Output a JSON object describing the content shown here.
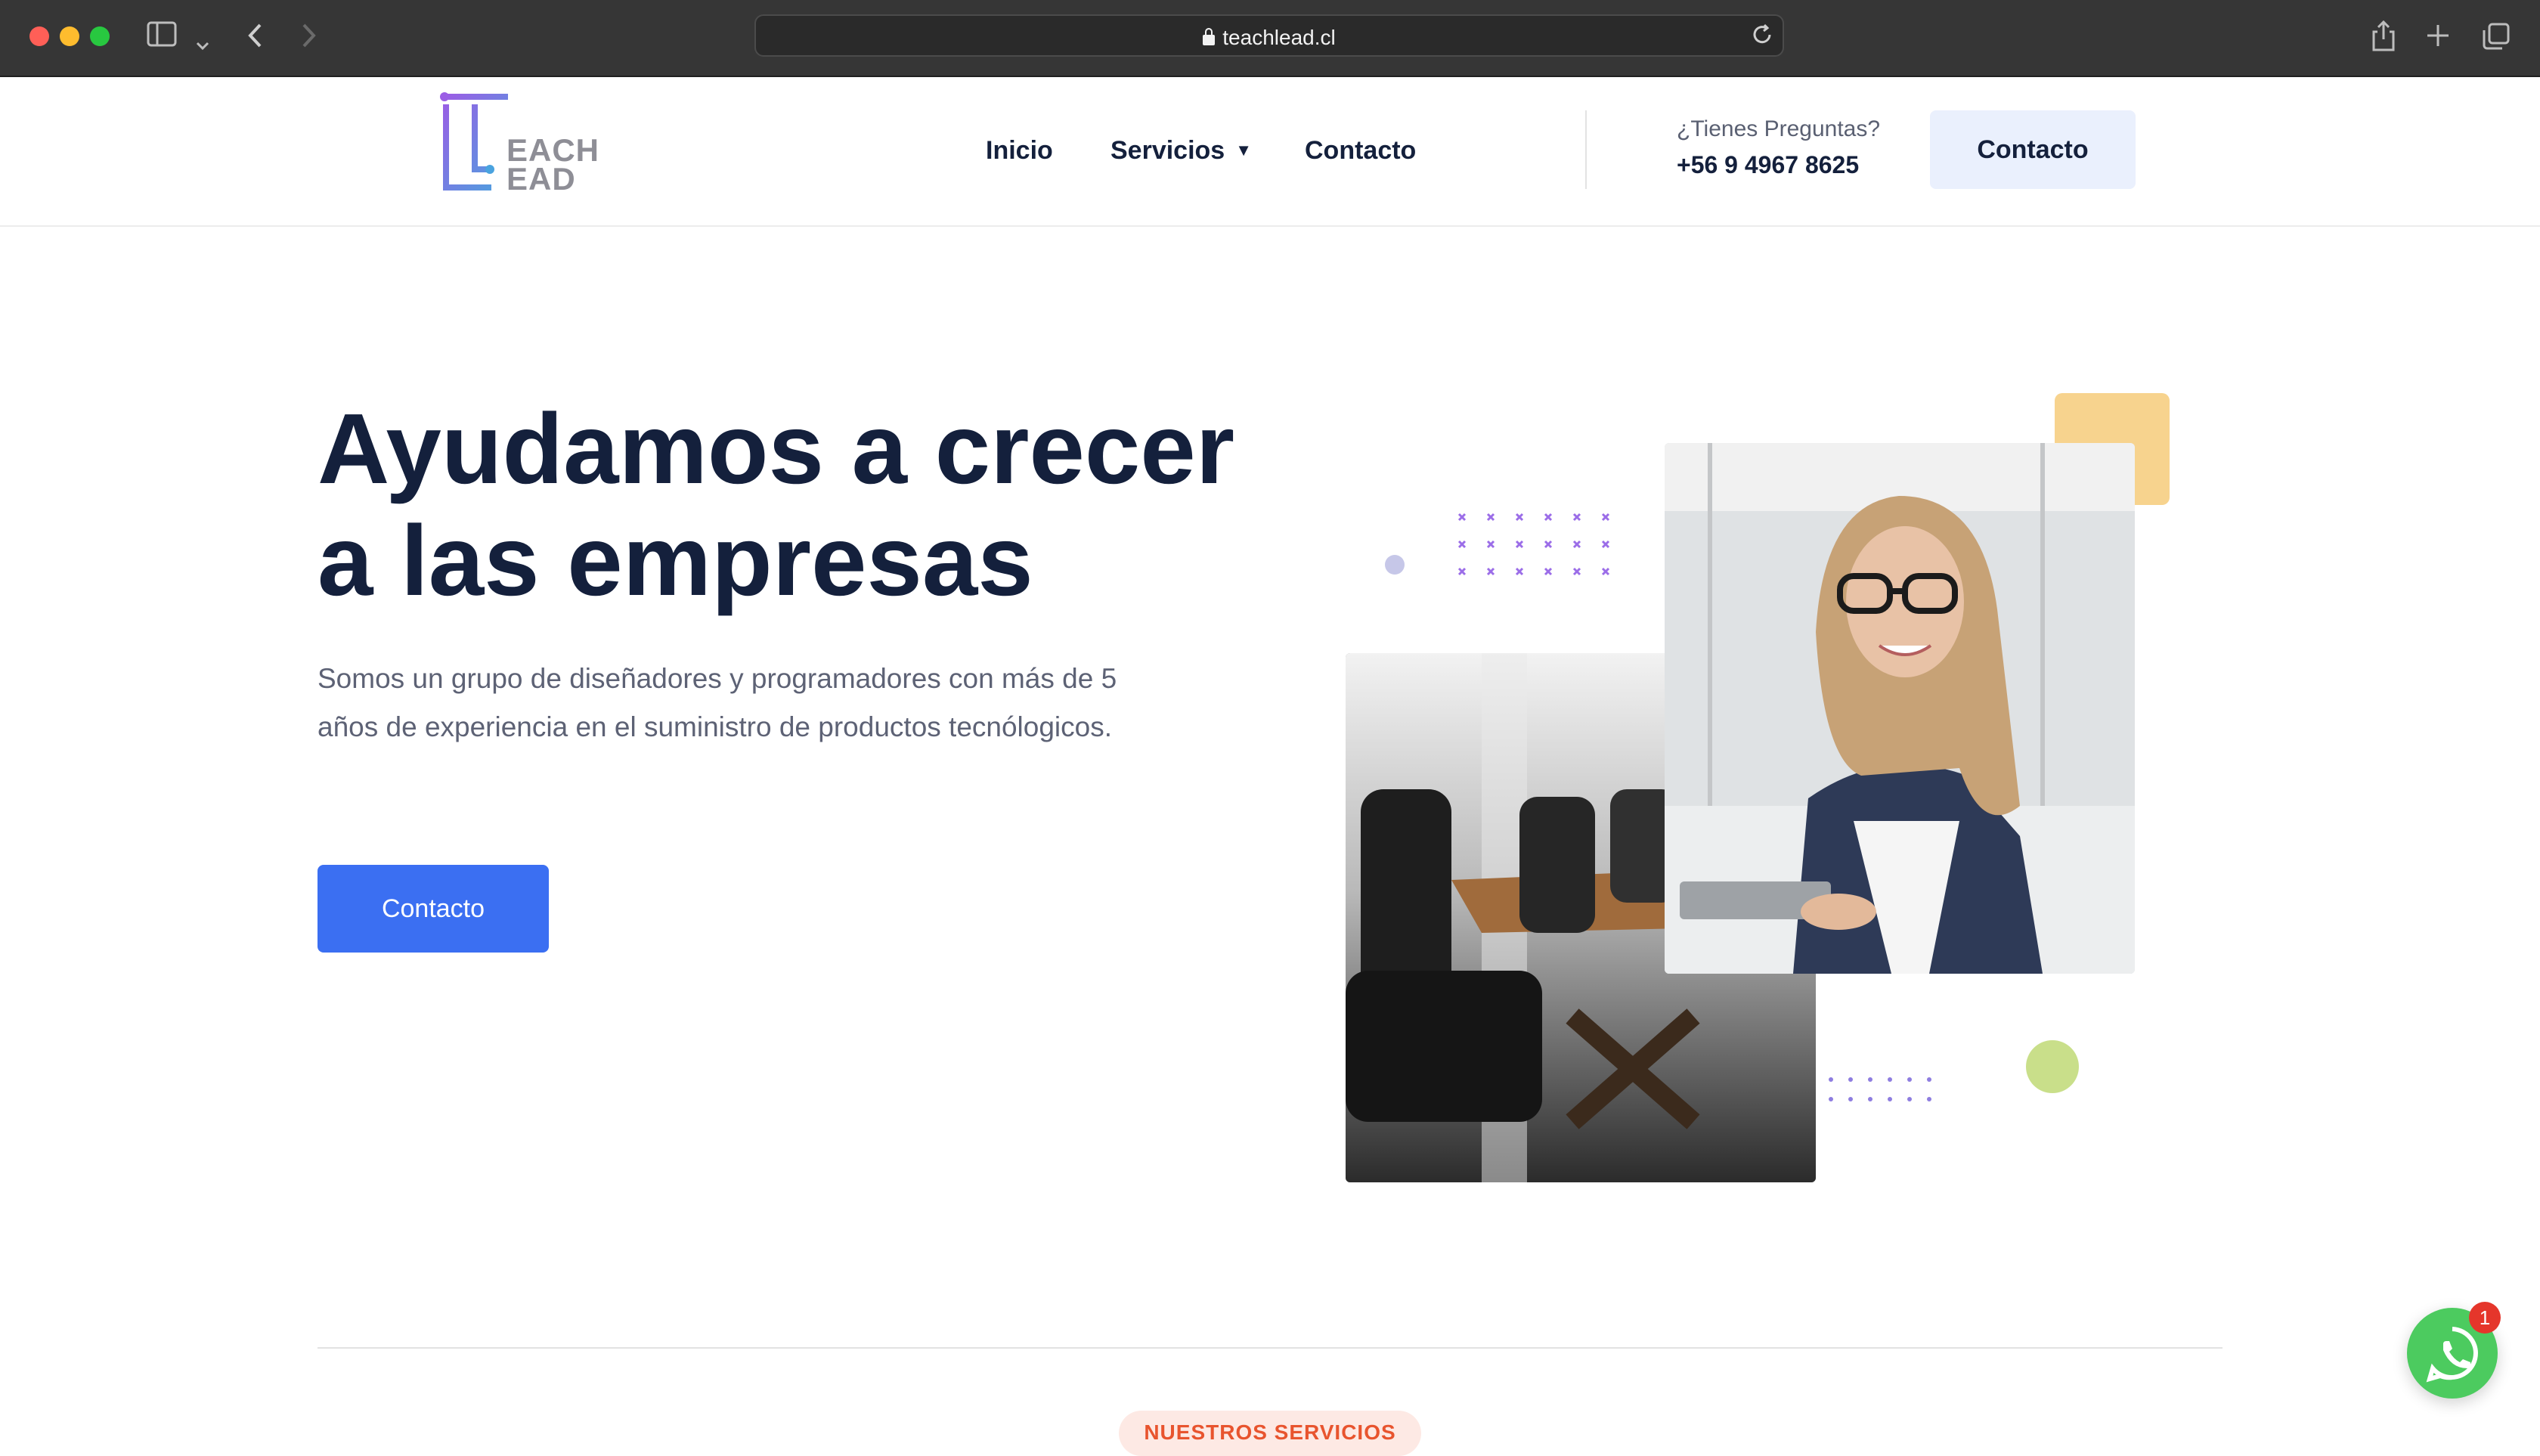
{
  "browser": {
    "url": "teachlead.cl"
  },
  "header": {
    "logo_text_line1": "EACH",
    "logo_text_line2": "EAD",
    "nav": [
      {
        "label": "Inicio"
      },
      {
        "label": "Servicios"
      },
      {
        "label": "Contacto"
      }
    ],
    "question_label": "¿Tienes Preguntas?",
    "phone": "+56 9 4967 8625",
    "contact_button": "Contacto"
  },
  "hero": {
    "title_line1": "Ayudamos a crecer",
    "title_line2": "a las empresas",
    "description": "Somos un grupo de diseñadores y programadores con más de 5 años de experiencia en el suministro de productos tecnólogicos.",
    "cta_button": "Contacto"
  },
  "section": {
    "label": "NUESTROS SERVICIOS"
  },
  "whatsapp": {
    "badge_count": "1"
  },
  "colors": {
    "accent": "#3b6ff2",
    "heading": "#14203c",
    "whatsapp": "#4ccb5f"
  }
}
